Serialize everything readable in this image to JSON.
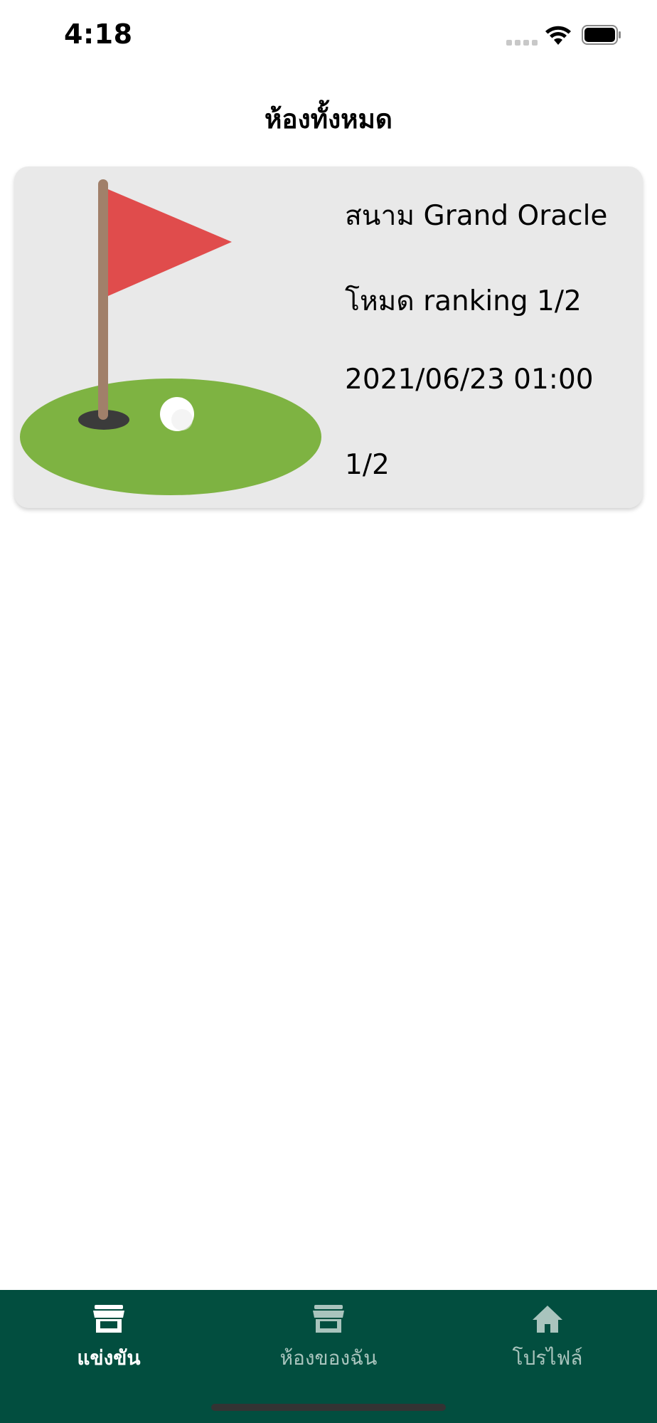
{
  "status_bar": {
    "time": "4:18"
  },
  "header": {
    "title": "ห้องทั้งหมด"
  },
  "rooms": [
    {
      "course": "สนาม Grand Oracle",
      "mode": "โหมด ranking 1/2",
      "datetime": "2021/06/23 01:00",
      "players": "1/2",
      "image_icon": "golf-flag-icon"
    }
  ],
  "tab_bar": {
    "tabs": [
      {
        "label": "แข่งขัน",
        "icon": "store-icon",
        "active": true
      },
      {
        "label": "ห้องของฉัน",
        "icon": "store-icon",
        "active": false
      },
      {
        "label": "โปรไฟล์",
        "icon": "home-icon",
        "active": false
      }
    ],
    "colors": {
      "background": "#024e3f",
      "active": "#ffffff",
      "inactive": "#a9c4bd"
    }
  }
}
